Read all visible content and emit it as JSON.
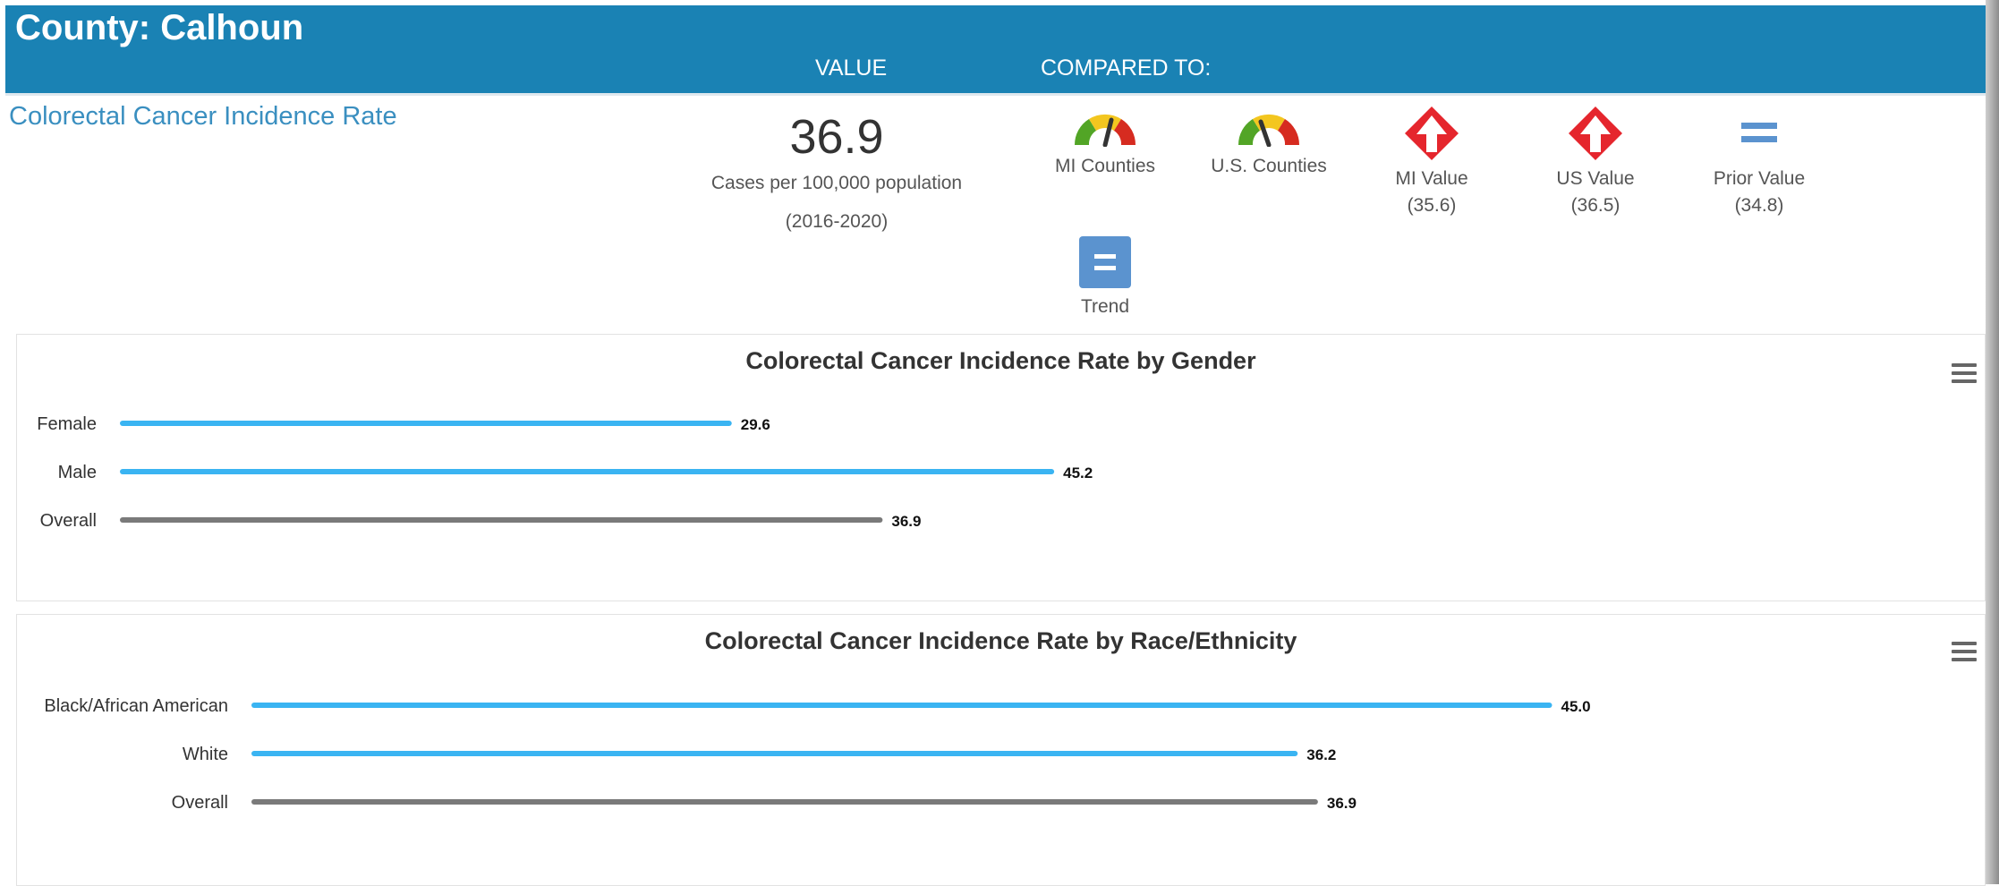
{
  "header": {
    "county_title": "County: Calhoun",
    "value_col": "VALUE",
    "compared_col": "COMPARED TO:"
  },
  "indicator": {
    "name": "Colorectal Cancer Incidence Rate",
    "value": "36.9",
    "unit": "Cases per 100,000 population",
    "period": "(2016-2020)"
  },
  "comparisons": [
    {
      "label": "MI Counties",
      "icon": "gauge-icon",
      "sub": ""
    },
    {
      "label": "U.S. Counties",
      "icon": "gauge-icon",
      "sub": ""
    },
    {
      "label": "MI Value",
      "icon": "red-up-arrow-icon",
      "sub": "(35.6)"
    },
    {
      "label": "US Value",
      "icon": "red-up-arrow-icon",
      "sub": "(36.5)"
    },
    {
      "label": "Prior Value",
      "icon": "equals-icon",
      "sub": "(34.8)"
    }
  ],
  "trend": {
    "label": "Trend",
    "icon": "equals-box-icon"
  },
  "colors": {
    "header": "#1a82b4",
    "link": "#3a8fc0",
    "bar_series": "#3ab4f2",
    "bar_overall": "#7a7a7a",
    "up_arrow": "#e5262d"
  },
  "chart_data": [
    {
      "type": "bar",
      "orientation": "horizontal",
      "title": "Colorectal Cancer Incidence Rate by Gender",
      "categories": [
        "Female",
        "Male",
        "Overall"
      ],
      "values": [
        29.6,
        45.2,
        36.9
      ],
      "labels": [
        "29.6",
        "45.2",
        "36.9"
      ],
      "xlim": [
        0,
        50
      ],
      "grid": false
    },
    {
      "type": "bar",
      "orientation": "horizontal",
      "title": "Colorectal Cancer Incidence Rate by Race/Ethnicity",
      "categories": [
        "Black/African American",
        "White",
        "Overall"
      ],
      "values": [
        45.0,
        36.2,
        36.9
      ],
      "labels": [
        "45.0",
        "36.2",
        "36.9"
      ],
      "xlim": [
        0,
        50
      ],
      "grid": false
    }
  ]
}
